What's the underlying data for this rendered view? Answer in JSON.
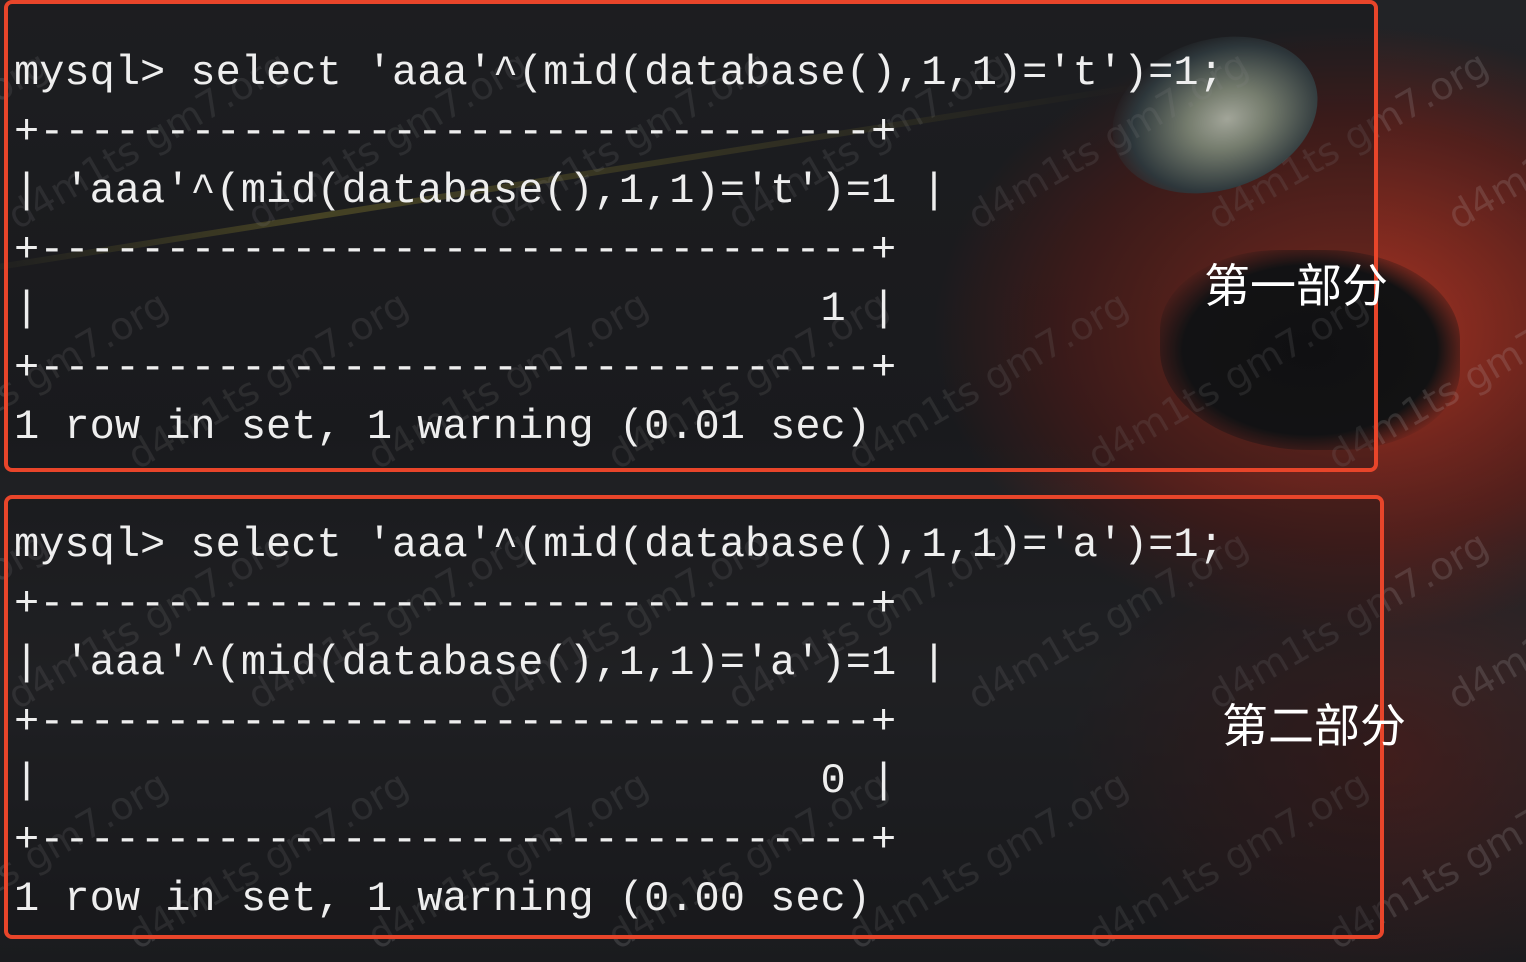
{
  "terminal_part1": {
    "lines": [
      "mysql> select 'aaa'^(mid(database(),1,1)='t')=1;",
      "+---------------------------------+",
      "| 'aaa'^(mid(database(),1,1)='t')=1 |",
      "+---------------------------------+",
      "|                               1 |",
      "+---------------------------------+",
      "1 row in set, 1 warning (0.01 sec)"
    ]
  },
  "terminal_part2": {
    "lines": [
      "mysql> select 'aaa'^(mid(database(),1,1)='a')=1;",
      "+---------------------------------+",
      "| 'aaa'^(mid(database(),1,1)='a')=1 |",
      "+---------------------------------+",
      "|                               0 |",
      "+---------------------------------+",
      "1 row in set, 1 warning (0.00 sec)"
    ]
  },
  "annotations": {
    "part1_label": "第一部分",
    "part2_label": "第二部分",
    "box_color": "#e8452a"
  },
  "watermark_text": "d4m1ts gm7.org"
}
